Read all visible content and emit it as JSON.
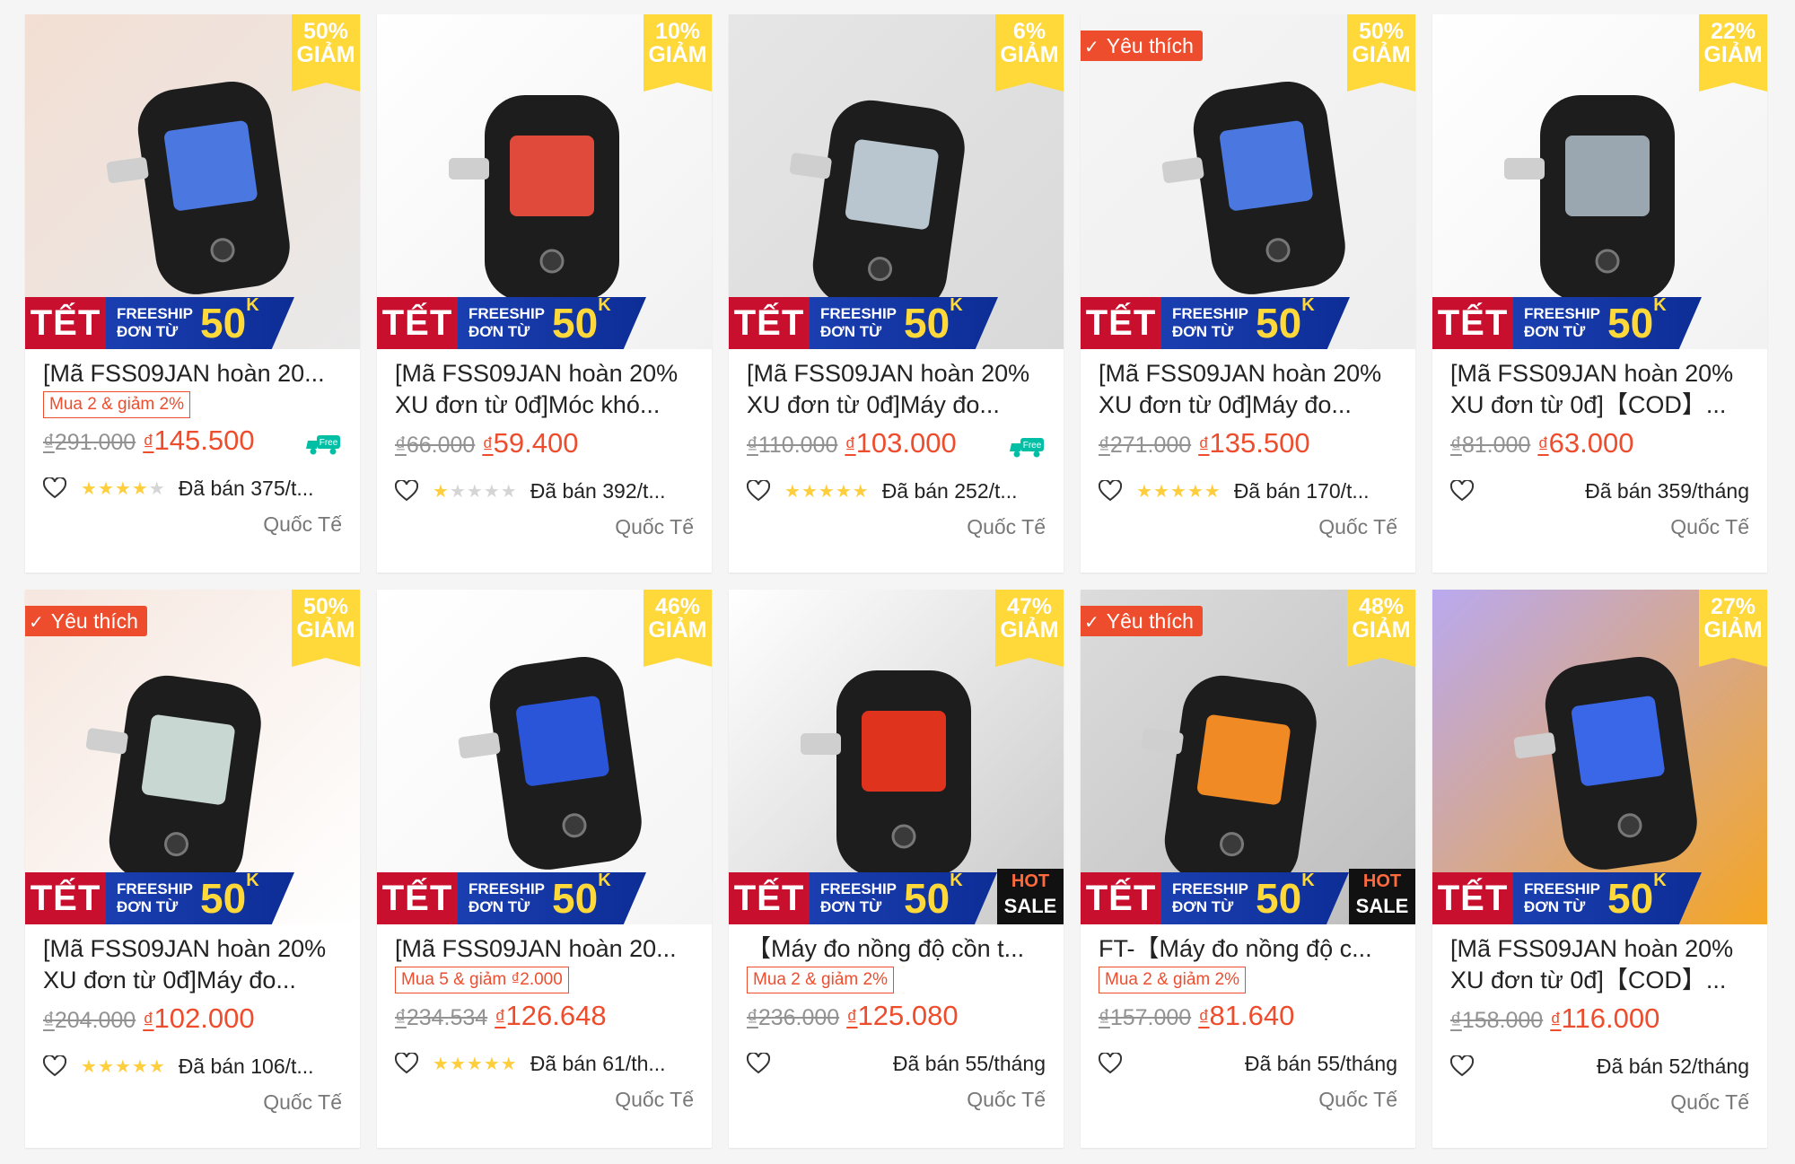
{
  "common": {
    "tet_label": "TẾT",
    "freeship_line1": "FREESHIP",
    "freeship_line2": "ĐƠN TỪ",
    "freeship_amount": "50",
    "freeship_unit": "K",
    "discount_label": "GIẢM",
    "favorite_label": "Yêu thích",
    "hot_label": "HOT",
    "sale_label": "SALE",
    "origin_label": "Quốc Tế",
    "currency": "₫",
    "free_ship_icon_text": "Free",
    "colors": {
      "accent": "#ee4d2d",
      "discount_bg": "#ffd839",
      "star": "#ffce3d",
      "tet_red": "#c8102e",
      "freeship_blue": "#1a3fb0"
    }
  },
  "products": [
    {
      "title": "[Mã FSS09JAN hoàn 20...",
      "promo": "Mua 2 & giảm 2%",
      "old_price": "291.000",
      "new_price": "145.500",
      "discount": "50%",
      "rating": 4.5,
      "sold": "Đã bán 375/t...",
      "favorite": false,
      "free_ship_icon": true,
      "hot_sale": false
    },
    {
      "title": "[Mã FSS09JAN hoàn 20% XU đơn từ 0đ]Móc khó...",
      "promo": "",
      "old_price": "66.000",
      "new_price": "59.400",
      "discount": "10%",
      "rating": 1,
      "sold": "Đã bán 392/t...",
      "favorite": false,
      "free_ship_icon": false,
      "hot_sale": false
    },
    {
      "title": "[Mã FSS09JAN hoàn 20% XU đơn từ 0đ]Máy đo...",
      "promo": "",
      "old_price": "110.000",
      "new_price": "103.000",
      "discount": "6%",
      "rating": 5,
      "sold": "Đã bán 252/t...",
      "favorite": false,
      "free_ship_icon": true,
      "hot_sale": false
    },
    {
      "title": "[Mã FSS09JAN hoàn 20% XU đơn từ 0đ]Máy đo...",
      "promo": "",
      "old_price": "271.000",
      "new_price": "135.500",
      "discount": "50%",
      "rating": 5,
      "sold": "Đã bán 170/t...",
      "favorite": true,
      "free_ship_icon": false,
      "hot_sale": false
    },
    {
      "title": "[Mã FSS09JAN hoàn 20% XU đơn từ 0đ]【COD】...",
      "promo": "",
      "old_price": "81.000",
      "new_price": "63.000",
      "discount": "22%",
      "rating": 0,
      "sold": "Đã bán 359/tháng",
      "favorite": false,
      "free_ship_icon": false,
      "hot_sale": false
    },
    {
      "title": "[Mã FSS09JAN hoàn 20% XU đơn từ 0đ]Máy đo...",
      "promo": "",
      "old_price": "204.000",
      "new_price": "102.000",
      "discount": "50%",
      "rating": 5,
      "sold": "Đã bán 106/t...",
      "favorite": true,
      "free_ship_icon": false,
      "hot_sale": false
    },
    {
      "title": "[Mã FSS09JAN hoàn 20...",
      "promo": "Mua 5 & giảm ₫2.000",
      "old_price": "234.534",
      "new_price": "126.648",
      "discount": "46%",
      "rating": 5,
      "sold": "Đã bán 61/th...",
      "favorite": false,
      "free_ship_icon": false,
      "hot_sale": false
    },
    {
      "title": "【Máy đo nồng độ cồn t...",
      "promo": "Mua 2 & giảm 2%",
      "old_price": "236.000",
      "new_price": "125.080",
      "discount": "47%",
      "rating": 0,
      "sold": "Đã bán 55/tháng",
      "favorite": false,
      "free_ship_icon": false,
      "hot_sale": true
    },
    {
      "title": "FT-【Máy đo nồng độ c...",
      "promo": "Mua 2 & giảm 2%",
      "old_price": "157.000",
      "new_price": "81.640",
      "discount": "48%",
      "rating": 0,
      "sold": "Đã bán 55/tháng",
      "favorite": true,
      "free_ship_icon": false,
      "hot_sale": true
    },
    {
      "title": "[Mã FSS09JAN hoàn 20% XU đơn từ 0đ]【COD】...",
      "promo": "",
      "old_price": "158.000",
      "new_price": "116.000",
      "discount": "27%",
      "rating": 0,
      "sold": "Đã bán 52/tháng",
      "favorite": false,
      "free_ship_icon": false,
      "hot_sale": false
    }
  ]
}
